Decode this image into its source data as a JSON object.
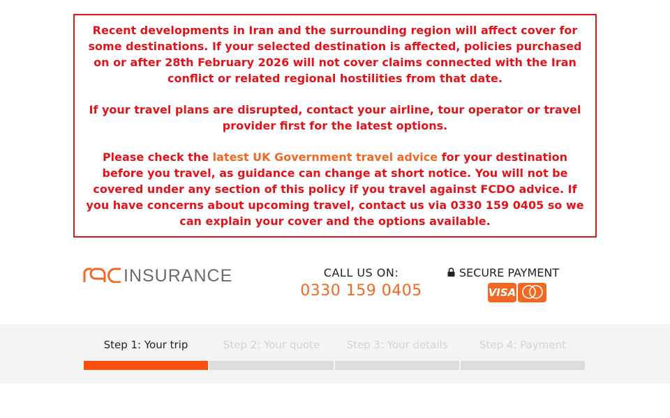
{
  "notice": {
    "para1": "Recent developments in Iran and the surrounding region will affect cover for some destinations. If your selected destination is affected, policies purchased on or after 28th February 2026 will not cover claims connected with the Iran conflict or related regional hostilities from that date.",
    "para2": "If your travel plans are disrupted, contact your airline, tour operator or travel provider first for the latest options.",
    "para3_before": "Please check the ",
    "para3_link": "latest UK Government travel advice",
    "para3_after": " for your destination before you travel, as guidance can change at short notice. You will not be covered under any section of this policy if you travel against FCDO advice. If you have concerns about upcoming travel, contact us via 0330 159 0405 so we can explain your cover and the options available."
  },
  "header": {
    "logo_rac": "RAC",
    "logo_insurance": "INSURANCE",
    "call_label": "CALL US ON:",
    "call_number": "0330 159 0405",
    "secure_label": "SECURE PAYMENT",
    "card_visa": "VISA",
    "card_mastercard": "mastercard"
  },
  "steps": [
    {
      "label": "Step 1: Your trip",
      "active": true
    },
    {
      "label": "Step 2: Your quote",
      "active": false
    },
    {
      "label": "Step 3: Your details",
      "active": false
    },
    {
      "label": "Step 4: Payment",
      "active": false
    }
  ],
  "colors": {
    "alert_red": "#e3131b",
    "brand_orange": "#f26722",
    "progress_active": "#fc5013",
    "progress_inactive": "#dcdcdc"
  },
  "icons": {
    "secure": "lock-icon"
  }
}
